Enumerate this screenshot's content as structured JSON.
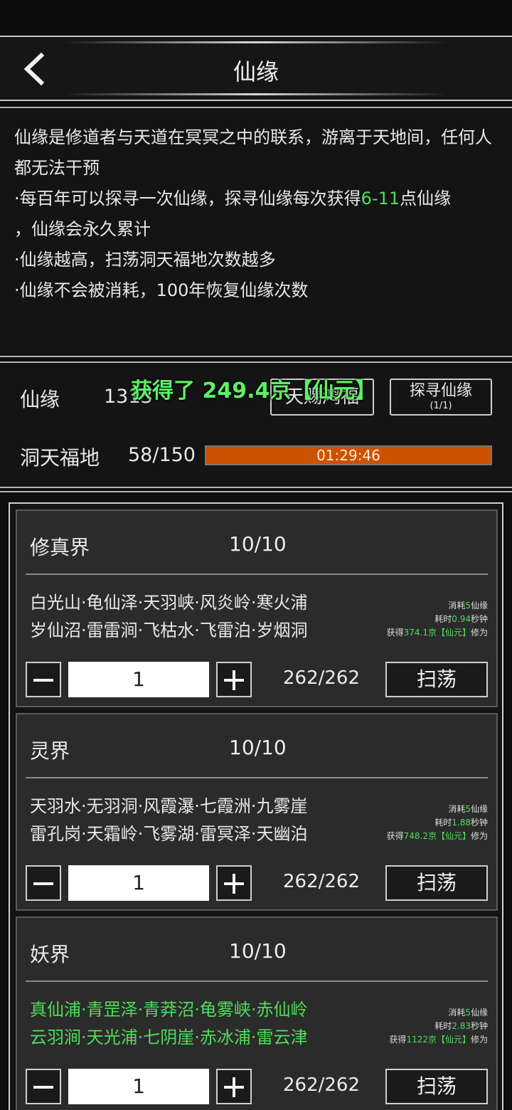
{
  "header": {
    "title": "仙缘"
  },
  "description": {
    "line1": "仙缘是修道者与天道在冥冥之中的联系，游离于天地间，任何人都无法干预",
    "line2_pre": "·每百年可以探寻一次仙缘，探寻仙缘每次获得",
    "line2_green": "6-11",
    "line2_post": "点仙缘",
    "line3": "，仙缘会永久累计",
    "line4": "·仙缘越高，扫荡洞天福地次数越多",
    "line5": "·仙缘不会被消耗，100年恢复仙缘次数"
  },
  "stats": {
    "xianyuan_label": "仙缘",
    "xianyuan_value": "1313",
    "gift_button": "天赐鸿福",
    "search_button": "探寻仙缘",
    "search_count": "(1/1)",
    "dongtian_label": "洞天福地",
    "dongtian_value": "58/150",
    "timer": "01:29:46",
    "toast": "获得了 249.4京【仙元】"
  },
  "realms": [
    {
      "name": "修真界",
      "count": "10/10",
      "places_line1": "白光山·龟仙泽·天羽峡·风炎岭·寒火浦",
      "places_line2": "岁仙沼·雷雷涧·飞枯水·飞雷泊·岁烟洞",
      "cost_pre": "消耗",
      "cost_val": "5",
      "cost_post": "仙缘",
      "time_pre": "耗时",
      "time_val": "0.94",
      "time_post": "秒钟",
      "gain_pre": "获得",
      "gain_val": "374.1京【仙元】",
      "gain_post": "修为",
      "quantity": "1",
      "remaining": "262/262",
      "sweep": "扫荡"
    },
    {
      "name": "灵界",
      "count": "10/10",
      "places_line1": "天羽水·无羽洞·风霞瀑·七霞洲·九雾崖",
      "places_line2": "雷孔岗·天霜岭·飞雾湖·雷冥泽·天幽泊",
      "cost_pre": "消耗",
      "cost_val": "5",
      "cost_post": "仙缘",
      "time_pre": "耗时",
      "time_val": "1.88",
      "time_post": "秒钟",
      "gain_pre": "获得",
      "gain_val": "748.2京【仙元】",
      "gain_post": "修为",
      "quantity": "1",
      "remaining": "262/262",
      "sweep": "扫荡"
    },
    {
      "name": "妖界",
      "count": "10/10",
      "places_line1": "真仙浦·青罡泽·青莽沼·龟雾峡·赤仙岭",
      "places_line2": "云羽涧·天光浦·七阴崖·赤冰浦·雷云津",
      "cost_pre": "消耗",
      "cost_val": "5",
      "cost_post": "仙缘",
      "time_pre": "耗时",
      "time_val": "2.83",
      "time_post": "秒钟",
      "gain_pre": "获得",
      "gain_val": "1122京【仙元】",
      "gain_post": "修为",
      "quantity": "1",
      "remaining": "262/262",
      "sweep": "扫荡"
    }
  ],
  "colors": {
    "accent_green": "#4fdc5a",
    "bar_orange": "#cc5200"
  }
}
